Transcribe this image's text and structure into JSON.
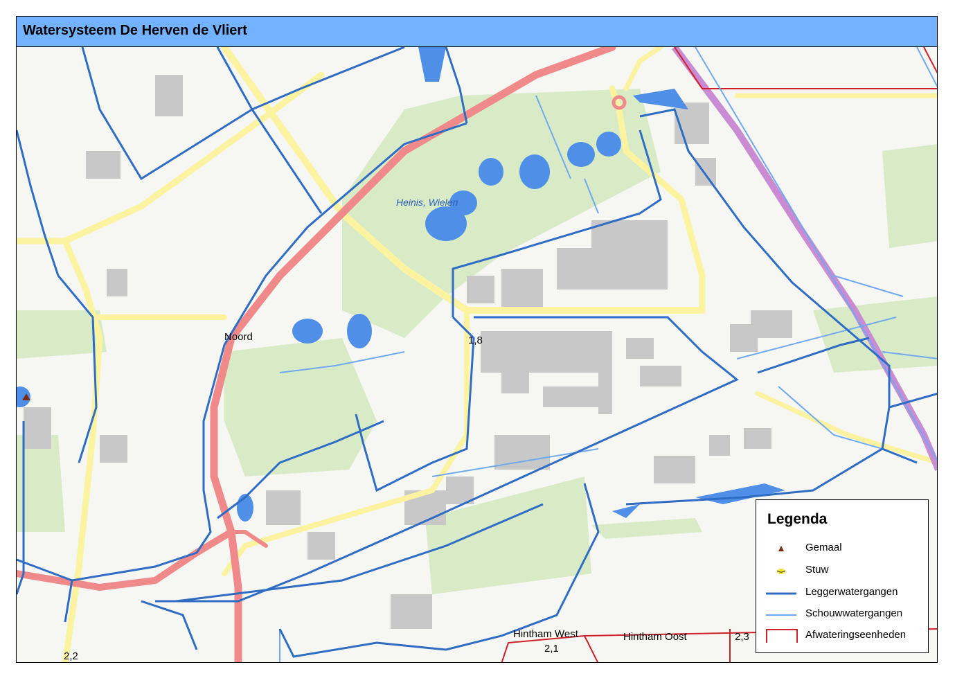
{
  "map": {
    "title": "Watersysteem De Herven de Vliert",
    "labels": {
      "heinis": "Heinis, Wielen",
      "noord": "Noord",
      "v18": "1,8",
      "hintham_west": "Hintham West",
      "v21": "2,1",
      "hintham_oost": "Hintham Oost",
      "v23": "2,3",
      "v22": "2,2"
    }
  },
  "legend": {
    "title": "Legenda",
    "items": [
      {
        "label": "Gemaal",
        "icon": "triangle-icon",
        "color": "#7a2a14"
      },
      {
        "label": "Stuw",
        "icon": "weir-icon",
        "color": "#f2e23a"
      },
      {
        "label": "Leggerwatergangen",
        "icon": "line-icon",
        "color": "#2f6cc4"
      },
      {
        "label": "Schouwwatergangen",
        "icon": "line-icon",
        "color": "#6fa9ef"
      },
      {
        "label": "Afwateringseenheden",
        "icon": "polygon-icon",
        "color": "#d0202a"
      }
    ]
  },
  "colors": {
    "water": "#4f8fe8",
    "legger": "#2f6cc4",
    "schouw": "#6fa9ef",
    "boundary": "#d0202a",
    "motorway": "#f08a8a",
    "railway": "#c98bd1",
    "road": "#fbf3a0",
    "green": "#d8ebc6",
    "building": "#c8c8c8"
  }
}
